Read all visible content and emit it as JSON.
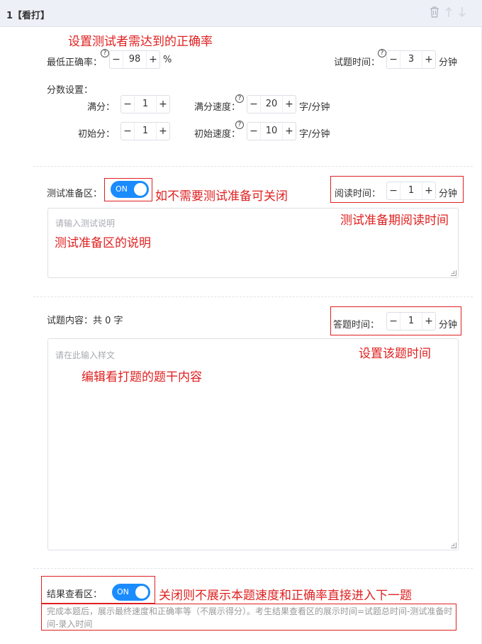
{
  "header": {
    "title": "1【看打】"
  },
  "annotations": {
    "accuracy": "设置测试者需达到的正确率",
    "prep_toggle": "如不需要测试准备可关闭",
    "read_time": "测试准备期阅读时间",
    "prep_desc": "测试准备区的说明",
    "answer_time": "设置该题时间",
    "content": "编辑看打题的题干内容",
    "result_toggle": "关闭则不展示本题速度和正确率直接进入下一题"
  },
  "settings": {
    "min_accuracy_label": "最低正确率：",
    "min_accuracy_value": "98",
    "min_accuracy_unit": "%",
    "exam_time_label": "试题时间：",
    "exam_time_value": "3",
    "minutes_unit": "分钟",
    "score_settings_label": "分数设置：",
    "full_score_label": "满分：",
    "full_score_value": "1",
    "full_speed_label": "满分速度：",
    "full_speed_value": "20",
    "speed_unit": "字/分钟",
    "initial_score_label": "初始分：",
    "initial_score_value": "1",
    "initial_speed_label": "初始速度：",
    "initial_speed_value": "10"
  },
  "prep": {
    "label": "测试准备区：",
    "toggle_text": "ON",
    "read_time_label": "阅读时间：",
    "read_time_value": "1",
    "placeholder": "请输入测试说明"
  },
  "content": {
    "label": "试题内容：共 0 字",
    "answer_time_label": "答题时间：",
    "answer_time_value": "1",
    "placeholder": "请在此输入样文"
  },
  "result": {
    "label": "结果查看区：",
    "toggle_text": "ON",
    "note": "完成本题后，展示最终速度和正确率等（不展示得分）。考生结果查看区的展示时间=试题总时间-测试准备时间-录入时间"
  },
  "icons": [
    "trash-icon",
    "arrow-up-icon",
    "arrow-down-icon",
    "help-icon"
  ],
  "colors": {
    "accent": "#1a8cff",
    "annotation": "#e02020",
    "header_bg": "#edf1f7"
  }
}
